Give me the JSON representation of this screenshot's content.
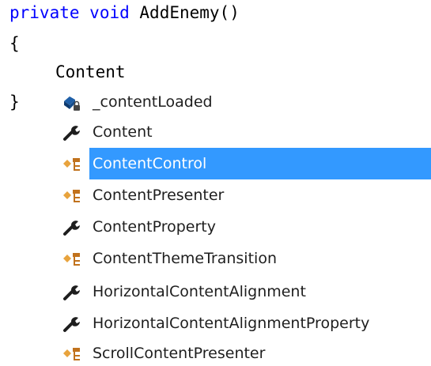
{
  "code": {
    "line1_kw1": "private",
    "line1_kw2": "void",
    "line1_rest": "AddEnemy()",
    "line2": "{",
    "line3": "Content",
    "line4": "}"
  },
  "completion": {
    "items": [
      {
        "label": "_contentLoaded",
        "icon": "private-field-icon"
      },
      {
        "label": "Content",
        "icon": "property-wrench-icon"
      },
      {
        "label": "ContentControl",
        "icon": "class-icon",
        "selected": true
      },
      {
        "label": "ContentPresenter",
        "icon": "class-icon"
      },
      {
        "label": "ContentProperty",
        "icon": "property-wrench-icon"
      },
      {
        "label": "ContentThemeTransition",
        "icon": "class-icon"
      },
      {
        "label": "HorizontalContentAlignment",
        "icon": "property-wrench-icon"
      },
      {
        "label": "HorizontalContentAlignmentProperty",
        "icon": "property-wrench-icon"
      },
      {
        "label": "ScrollContentPresenter",
        "icon": "class-icon"
      }
    ],
    "selection_color": "#3399ff"
  }
}
